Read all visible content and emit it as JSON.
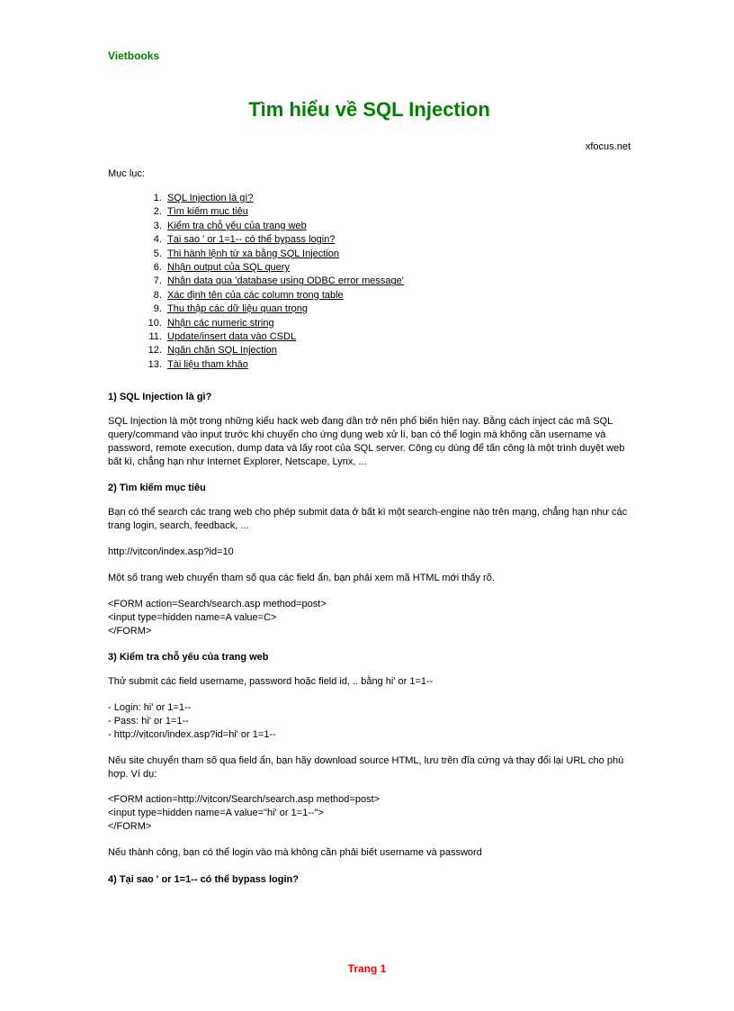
{
  "brand": "Vietbooks",
  "title": "Tìm hiểu về SQL Injection",
  "source": "xfocus.net",
  "toc_label": "Mục lục:",
  "toc": [
    "SQL Injection là gì?",
    "Tìm kiếm mục tiêu",
    "Kiểm tra chỗ yếu của trang web",
    "Tại sao ' or 1=1-- có thể bypass login?",
    "Thi hành lệnh từ xa bằng SQL Injection",
    "Nhận output của SQL query",
    "Nhận data qua 'database using ODBC error message'",
    "Xác định tên của các column trong table",
    "Thu thập các dữ liệu quan trọng",
    "Nhận các numeric string",
    "Update/insert data vào CSDL",
    "Ngăn chặn SQL Injection",
    "Tài liệu tham khảo"
  ],
  "sections": {
    "s1": {
      "heading": "1) SQL Injection là gì?",
      "p1": "SQL Injection là một trong những kiểu hack web đang dần trở nên phổ biến hiện nay. Bằng cách inject các mã SQL query/command vào input trước khi chuyển cho ứng dụng web xử lí, bạn có thể login mà không cần username và password, remote execution, dump data và lấy root của SQL server. Công cụ dùng để tấn công là một trình duyệt web bất kì, chẳng hạn như Internet Explorer, Netscape, Lynx, ..."
    },
    "s2": {
      "heading": "2) Tìm kiếm mục tiêu",
      "p1": "Bạn có thể search các trang web cho phép submit data ở bất kì một search-engine nào trên mạng, chẳng hạn như các trang login, search, feedback, ...",
      "p2": "http://vịtcon/index.asp?id=10",
      "p3": "Một số trang web chuyển tham số qua các field ẩn, bạn phải xem mã HTML mới thấy rõ.",
      "code1": "<FORM action=Search/search.asp method=post>\n<input type=hidden name=A value=C>\n</FORM>"
    },
    "s3": {
      "heading": "3) Kiểm tra chỗ yếu của trang web",
      "p1": "Thử submit các field username, password hoặc field id, .. bằng hi' or 1=1--",
      "code1": "- Login: hi' or 1=1--\n- Pass: hi' or 1=1--\n- http://vịtcon/index.asp?id=hi' or 1=1--",
      "p2": "Nếu site chuyển tham số qua field ẩn, bạn hãy download source HTML, lưu trên đĩa cứng và thay đổi lại URL cho phù hợp. Ví dụ:",
      "code2": "<FORM action=http://vịtcon/Search/search.asp method=post>\n<input type=hidden name=A value=\"hi' or 1=1--\">\n</FORM>",
      "p3": "Nếu thành công, bạn có thể login vào mà không cần phải biết username và password"
    },
    "s4": {
      "heading": "4) Tại sao ' or 1=1-- có thể bypass login?"
    }
  },
  "footer": "Trang 1"
}
